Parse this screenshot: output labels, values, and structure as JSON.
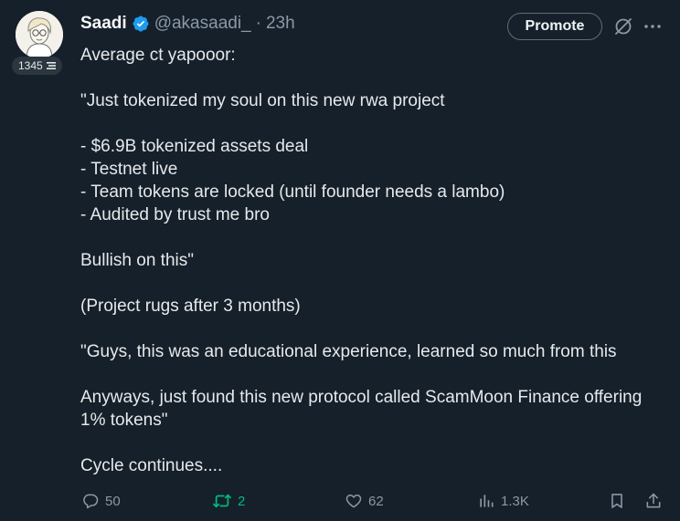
{
  "author": {
    "display_name": "Saadi",
    "handle": "@akasaadi_",
    "separator": "·",
    "time": "23h",
    "score": "1345"
  },
  "header": {
    "promote_label": "Promote"
  },
  "tweet": {
    "lines": [
      "Average ct yapooor:",
      "",
      "\"Just tokenized my soul on this new rwa project",
      "",
      "- $6.9B tokenized assets deal",
      "- Testnet live",
      "- Team tokens are locked (until founder needs a lambo)",
      "- Audited by trust me bro",
      "",
      "Bullish on this\"",
      "",
      "(Project rugs after 3 months)",
      "",
      "\"Guys, this was an educational experience, learned so much from this",
      "",
      "Anyways, just found this new protocol called ScamMoon Finance offering",
      "1% tokens\"",
      "",
      "Cycle continues...."
    ]
  },
  "actions": {
    "replies": "50",
    "reposts": "2",
    "likes": "62",
    "views": "1.3K"
  },
  "colors": {
    "background": "#15202b",
    "text": "#e7e9ea",
    "muted": "#8b98a5",
    "verified": "#1d9bf0",
    "repost_active": "#00ba7c"
  },
  "icons": {
    "verified": "verified-badge-icon",
    "grok": "grok-icon",
    "more": "more-icon",
    "reply": "reply-icon",
    "repost": "repost-icon",
    "like": "heart-icon",
    "views": "views-icon",
    "bookmark": "bookmark-icon",
    "share": "share-icon"
  }
}
